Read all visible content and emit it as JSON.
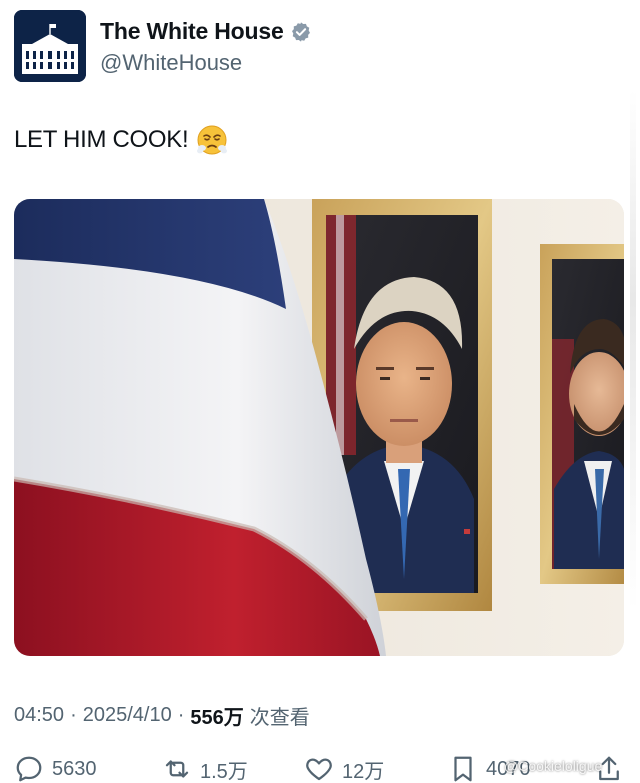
{
  "account": {
    "display_name": "The White House",
    "handle": "@WhiteHouse",
    "verified_icon": "verified-badge-icon",
    "verified_color": "#8a9aa9"
  },
  "tweet": {
    "text": "LET HIM COOK!",
    "emoji": "steam-face-emoji"
  },
  "meta": {
    "time": "04:50",
    "sep1": "·",
    "date": "2025/4/10",
    "sep2": "·",
    "views_count": "556万",
    "views_label": "次查看"
  },
  "actions": {
    "replies": "5630",
    "retweets": "1.5万",
    "likes": "12万",
    "bookmarks": "4070"
  },
  "watermark": "@Cookieloligue",
  "colors": {
    "text": "#0f1419",
    "secondary": "#536471",
    "avatar_bg": "#0d2347"
  }
}
